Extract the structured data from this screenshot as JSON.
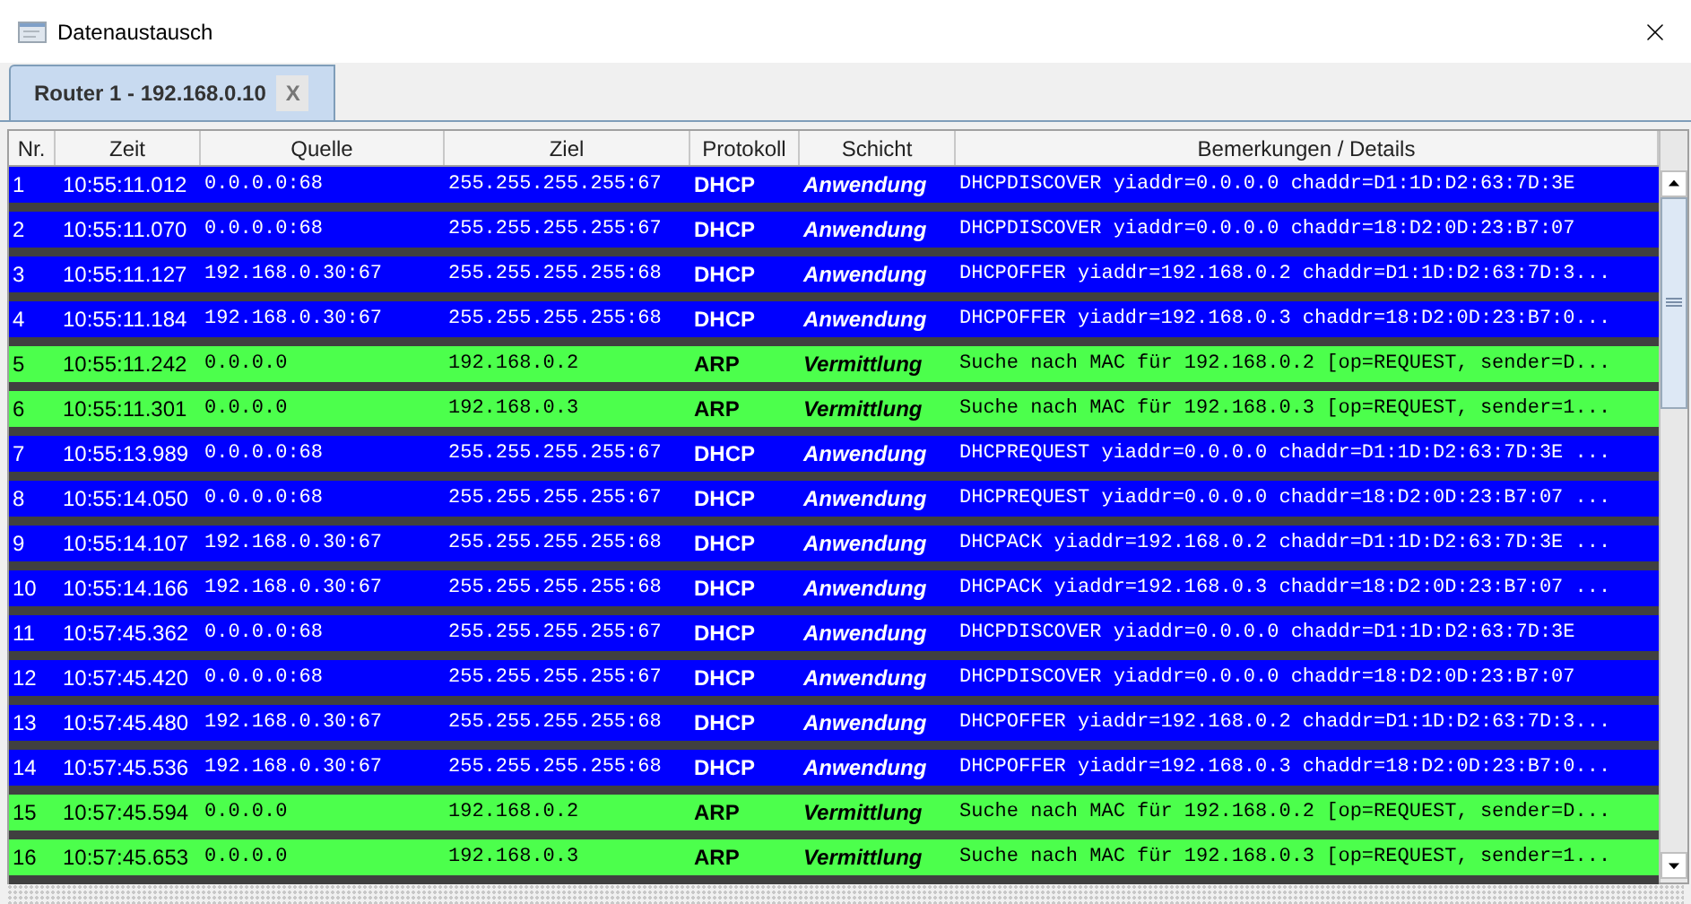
{
  "window": {
    "title": "Datenaustausch"
  },
  "tabs": [
    {
      "label": "Router 1 - 192.168.0.10",
      "close": "X",
      "selected": true
    }
  ],
  "table": {
    "columns": [
      "Nr.",
      "Zeit",
      "Quelle",
      "Ziel",
      "Protokoll",
      "Schicht",
      "Bemerkungen / Details"
    ],
    "rows": [
      {
        "kind": "dhcp",
        "cells": [
          "1",
          "10:55:11.012",
          "0.0.0.0:68",
          "255.255.255.255:67",
          "DHCP",
          "Anwendung",
          "DHCPDISCOVER yiaddr=0.0.0.0 chaddr=D1:1D:D2:63:7D:3E"
        ]
      },
      {
        "kind": "dhcp",
        "cells": [
          "2",
          "10:55:11.070",
          "0.0.0.0:68",
          "255.255.255.255:67",
          "DHCP",
          "Anwendung",
          "DHCPDISCOVER yiaddr=0.0.0.0 chaddr=18:D2:0D:23:B7:07"
        ]
      },
      {
        "kind": "dhcp",
        "cells": [
          "3",
          "10:55:11.127",
          "192.168.0.30:67",
          "255.255.255.255:68",
          "DHCP",
          "Anwendung",
          "DHCPOFFER yiaddr=192.168.0.2 chaddr=D1:1D:D2:63:7D:3..."
        ]
      },
      {
        "kind": "dhcp",
        "cells": [
          "4",
          "10:55:11.184",
          "192.168.0.30:67",
          "255.255.255.255:68",
          "DHCP",
          "Anwendung",
          "DHCPOFFER yiaddr=192.168.0.3 chaddr=18:D2:0D:23:B7:0..."
        ]
      },
      {
        "kind": "arp",
        "cells": [
          "5",
          "10:55:11.242",
          "0.0.0.0",
          "192.168.0.2",
          "ARP",
          "Vermittlung",
          "Suche nach MAC für 192.168.0.2 [op=REQUEST, sender=D..."
        ]
      },
      {
        "kind": "arp",
        "cells": [
          "6",
          "10:55:11.301",
          "0.0.0.0",
          "192.168.0.3",
          "ARP",
          "Vermittlung",
          "Suche nach MAC für 192.168.0.3 [op=REQUEST, sender=1..."
        ]
      },
      {
        "kind": "dhcp",
        "cells": [
          "7",
          "10:55:13.989",
          "0.0.0.0:68",
          "255.255.255.255:67",
          "DHCP",
          "Anwendung",
          "DHCPREQUEST yiaddr=0.0.0.0 chaddr=D1:1D:D2:63:7D:3E ..."
        ]
      },
      {
        "kind": "dhcp",
        "cells": [
          "8",
          "10:55:14.050",
          "0.0.0.0:68",
          "255.255.255.255:67",
          "DHCP",
          "Anwendung",
          "DHCPREQUEST yiaddr=0.0.0.0 chaddr=18:D2:0D:23:B7:07 ..."
        ]
      },
      {
        "kind": "dhcp",
        "cells": [
          "9",
          "10:55:14.107",
          "192.168.0.30:67",
          "255.255.255.255:68",
          "DHCP",
          "Anwendung",
          "DHCPACK yiaddr=192.168.0.2 chaddr=D1:1D:D2:63:7D:3E ..."
        ]
      },
      {
        "kind": "dhcp",
        "cells": [
          "10",
          "10:55:14.166",
          "192.168.0.30:67",
          "255.255.255.255:68",
          "DHCP",
          "Anwendung",
          "DHCPACK yiaddr=192.168.0.3 chaddr=18:D2:0D:23:B7:07 ..."
        ]
      },
      {
        "kind": "dhcp",
        "cells": [
          "11",
          "10:57:45.362",
          "0.0.0.0:68",
          "255.255.255.255:67",
          "DHCP",
          "Anwendung",
          "DHCPDISCOVER yiaddr=0.0.0.0 chaddr=D1:1D:D2:63:7D:3E"
        ]
      },
      {
        "kind": "dhcp",
        "cells": [
          "12",
          "10:57:45.420",
          "0.0.0.0:68",
          "255.255.255.255:67",
          "DHCP",
          "Anwendung",
          "DHCPDISCOVER yiaddr=0.0.0.0 chaddr=18:D2:0D:23:B7:07"
        ]
      },
      {
        "kind": "dhcp",
        "cells": [
          "13",
          "10:57:45.480",
          "192.168.0.30:67",
          "255.255.255.255:68",
          "DHCP",
          "Anwendung",
          "DHCPOFFER yiaddr=192.168.0.2 chaddr=D1:1D:D2:63:7D:3..."
        ]
      },
      {
        "kind": "dhcp",
        "cells": [
          "14",
          "10:57:45.536",
          "192.168.0.30:67",
          "255.255.255.255:68",
          "DHCP",
          "Anwendung",
          "DHCPOFFER yiaddr=192.168.0.3 chaddr=18:D2:0D:23:B7:0..."
        ]
      },
      {
        "kind": "arp",
        "cells": [
          "15",
          "10:57:45.594",
          "0.0.0.0",
          "192.168.0.2",
          "ARP",
          "Vermittlung",
          "Suche nach MAC für 192.168.0.2 [op=REQUEST, sender=D..."
        ]
      },
      {
        "kind": "arp",
        "cells": [
          "16",
          "10:57:45.653",
          "0.0.0.0",
          "192.168.0.3",
          "ARP",
          "Vermittlung",
          "Suche nach MAC für 192.168.0.3 [op=REQUEST, sender=1..."
        ]
      }
    ]
  }
}
